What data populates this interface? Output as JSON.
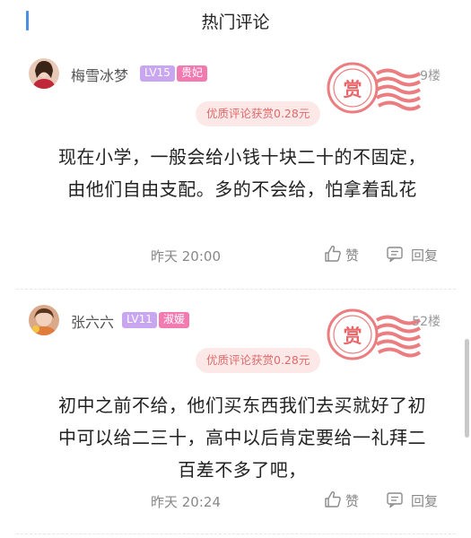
{
  "header": {
    "title": "热门评论"
  },
  "comments": [
    {
      "username": "梅雪冰梦",
      "level": "LV15",
      "title_badge": "贵妃",
      "floor": "9楼",
      "stamp_text": "赏",
      "reward": "优质评论获赏0.28元",
      "content": "现在小学，一般会给小钱十块二十的不固定，由他们自由支配。多的不会给，怕拿着乱花",
      "time": "昨天 20:00",
      "like_label": "赞",
      "reply_label": "回复"
    },
    {
      "username": "张六六",
      "level": "LV11",
      "title_badge": "淑媛",
      "floor": "52楼",
      "stamp_text": "赏",
      "reward": "优质评论获赏0.28元",
      "content": "初中之前不给，他们买东西我们去买就好了初中可以给二三十，高中以后肯定要给一礼拜二百差不多了吧，",
      "time": "昨天 20:24",
      "like_label": "赞",
      "reply_label": "回复"
    }
  ],
  "colors": {
    "accent": "#4a90e2",
    "level_badge": "#c8a6f0",
    "title_badge": "#f27ab1",
    "stamp": "#e8676a",
    "reward_bg": "#fde8e8"
  },
  "icons": {
    "like": "thumbs-up-icon",
    "reply": "comment-icon",
    "stamp": "reward-stamp-icon"
  }
}
